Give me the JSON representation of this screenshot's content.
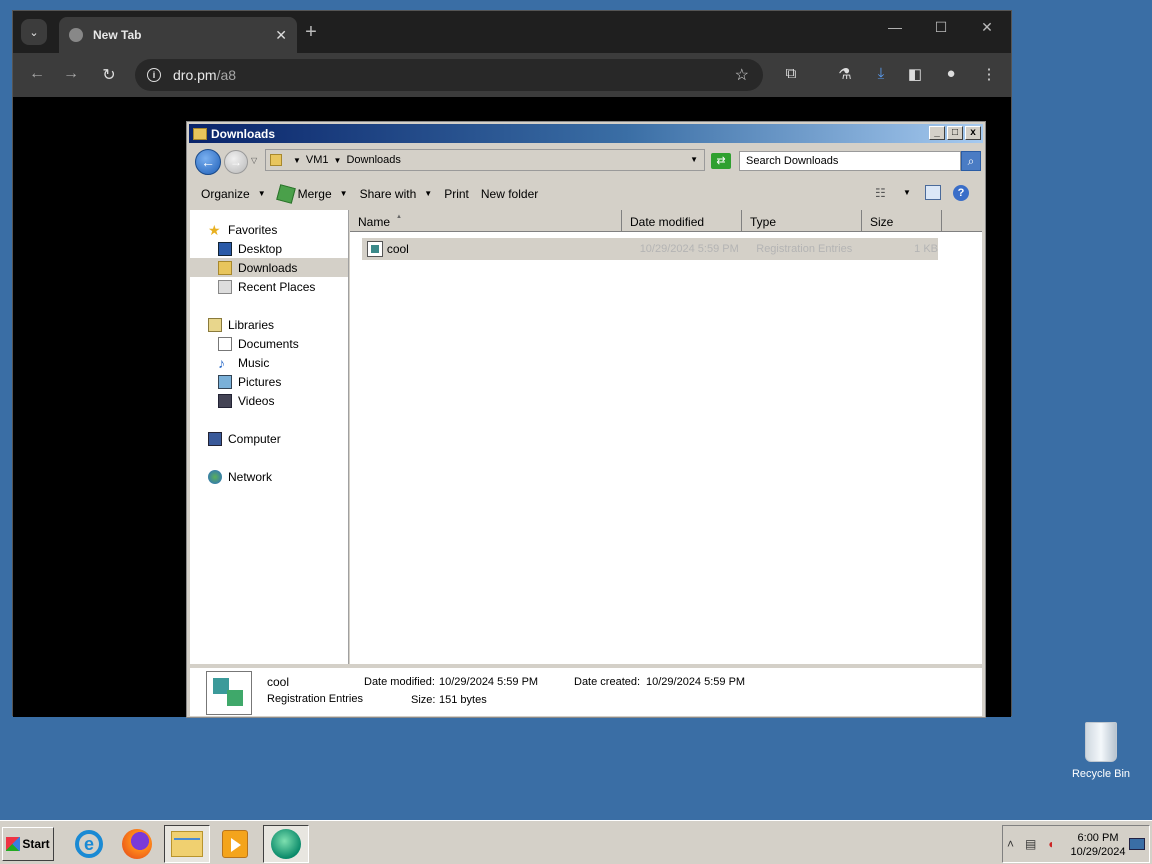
{
  "browser": {
    "tab_title": "New Tab",
    "tab_close": "✕",
    "new_tab": "+",
    "url_host": "dro.pm",
    "url_path": "/a8",
    "window_controls": {
      "minimize": "—",
      "maximize": "☐",
      "close": "✕"
    }
  },
  "explorer": {
    "title": "Downloads",
    "title_buttons": [
      "_",
      "□",
      "x"
    ],
    "breadcrumb": [
      "VM1",
      "Downloads"
    ],
    "search_placeholder": "Search Downloads",
    "commands": {
      "organize": "Organize",
      "merge": "Merge",
      "share_with": "Share with",
      "print": "Print",
      "new_folder": "New folder"
    },
    "nav": {
      "favorites": "Favorites",
      "desktop": "Desktop",
      "downloads": "Downloads",
      "recent_places": "Recent Places",
      "libraries": "Libraries",
      "documents": "Documents",
      "music": "Music",
      "pictures": "Pictures",
      "videos": "Videos",
      "computer": "Computer",
      "network": "Network"
    },
    "columns": {
      "name": "Name",
      "date_modified": "Date modified",
      "type": "Type",
      "size": "Size"
    },
    "files": [
      {
        "name": "cool",
        "date_modified": "10/29/2024 5:59 PM",
        "type": "Registration Entries",
        "size": "1 KB"
      }
    ],
    "details": {
      "name": "cool",
      "type": "Registration Entries",
      "date_modified_label": "Date modified:",
      "date_modified": "10/29/2024 5:59 PM",
      "date_created_label": "Date created:",
      "date_created": "10/29/2024 5:59 PM",
      "size_label": "Size:",
      "size": "151 bytes"
    }
  },
  "desktop": {
    "recycle_bin": "Recycle Bin"
  },
  "taskbar": {
    "start": "Start",
    "time": "6:00 PM",
    "date": "10/29/2024"
  }
}
